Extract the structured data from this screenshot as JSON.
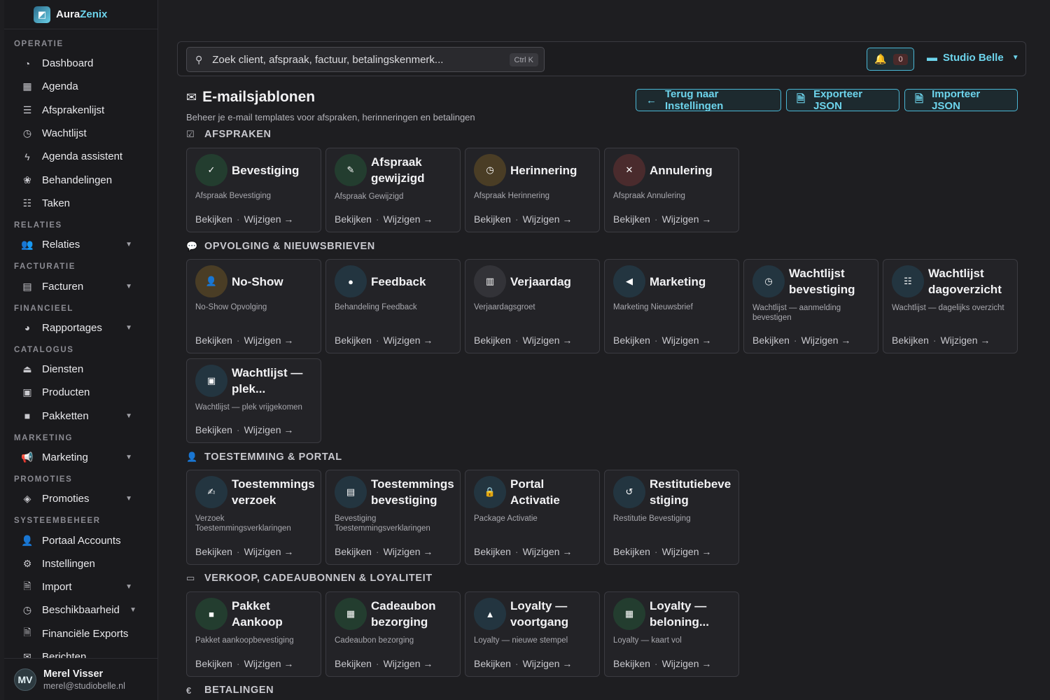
{
  "brand": {
    "name_part1": "Aura",
    "name_part2": "Zenix"
  },
  "sidebar": {
    "sections": [
      {
        "label": "OPERATIE"
      },
      {
        "label": "RELATIES"
      },
      {
        "label": "FACTURATIE"
      },
      {
        "label": "FINANCIEEL"
      },
      {
        "label": "CATALOGUS"
      },
      {
        "label": "MARKETING"
      },
      {
        "label": "PROMOTIES"
      },
      {
        "label": "SYSTEEMBEHEER"
      }
    ],
    "items": [
      {
        "label": "Dashboard",
        "icon": "dashboard-icon"
      },
      {
        "label": "Agenda",
        "icon": "calendar-icon"
      },
      {
        "label": "Afsprakenlijst",
        "icon": "list-icon"
      },
      {
        "label": "Wachtlijst",
        "icon": "clock-icon"
      },
      {
        "label": "Agenda assistent",
        "icon": "bolt-icon"
      },
      {
        "label": "Behandelingen",
        "icon": "lotus-icon"
      },
      {
        "label": "Taken",
        "icon": "tasks-icon"
      },
      {
        "label": "Relaties",
        "icon": "users-icon"
      },
      {
        "label": "Facturen",
        "icon": "invoice-icon"
      },
      {
        "label": "Rapportages",
        "icon": "pie-chart-icon"
      },
      {
        "label": "Diensten",
        "icon": "service-icon"
      },
      {
        "label": "Producten",
        "icon": "products-icon"
      },
      {
        "label": "Pakketten",
        "icon": "package-icon"
      },
      {
        "label": "Marketing",
        "icon": "megaphone-icon"
      },
      {
        "label": "Promoties",
        "icon": "tags-icon"
      },
      {
        "label": "Portaal Accounts",
        "icon": "user-cog-icon"
      },
      {
        "label": "Instellingen",
        "icon": "gear-icon"
      },
      {
        "label": "Import",
        "icon": "file-import-icon"
      },
      {
        "label": "Beschikbaarheid",
        "icon": "clock-icon"
      },
      {
        "label": "Financiële Exports",
        "icon": "file-export-icon"
      },
      {
        "label": "Berichten",
        "icon": "envelope-open-icon"
      }
    ]
  },
  "user": {
    "initials": "MV",
    "name": "Merel Visser",
    "email": "merel@studiobelle.nl"
  },
  "search": {
    "placeholder": "Zoek client, afspraak, factuur, betalingskenmerk...",
    "shortcut": "Ctrl K"
  },
  "notifications": {
    "count": "0"
  },
  "studio": {
    "label": "Studio Belle"
  },
  "page": {
    "title": "E-mailsjablonen",
    "subtitle": "Beheer je e-mail templates voor afspraken, herinneringen en betalingen",
    "buttons": {
      "back": "Terug naar Instellingen",
      "export": "Exporteer JSON",
      "import": "Importeer JSON"
    }
  },
  "card_actions": {
    "view": "Bekijken",
    "edit": "Wijzigen →"
  },
  "sections": {
    "afspraken": "AFSPRAKEN",
    "opvolging": "OPVOLGING & NIEUWSBRIEVEN",
    "toestemming": "TOESTEMMING & PORTAL",
    "verkoop": "VERKOOP, CADEAUBONNEN & LOYALITEIT",
    "betalingen": "BETALINGEN"
  },
  "cards": {
    "afspraken": [
      {
        "title": "Bevestiging",
        "subtitle": "Afspraak Bevestiging",
        "icon": "check-icon",
        "color": "#233d2f"
      },
      {
        "title": "Afspraak gewijzigd",
        "subtitle": "Afspraak Gewijzigd",
        "icon": "pencil-icon",
        "color": "#233d2f"
      },
      {
        "title": "Herinnering",
        "subtitle": "Afspraak Herinnering",
        "icon": "clock-icon",
        "color": "#4a3d25"
      },
      {
        "title": "Annulering",
        "subtitle": "Afspraak Annulering",
        "icon": "close-icon",
        "color": "#4a2b2d"
      }
    ],
    "opvolging": [
      {
        "title": "No-Show",
        "subtitle": "No-Show Opvolging",
        "icon": "user-x-icon",
        "color": "#4a3d25"
      },
      {
        "title": "Feedback",
        "subtitle": "Behandeling Feedback",
        "icon": "chat-icon",
        "color": "#233540"
      },
      {
        "title": "Verjaardag",
        "subtitle": "Verjaardagsgroet",
        "icon": "cake-icon",
        "color": "#333338"
      },
      {
        "title": "Marketing",
        "subtitle": "Marketing Nieuwsbrief",
        "icon": "megaphone-icon",
        "color": "#233540"
      },
      {
        "title": "Wachtlijst bevestiging",
        "subtitle": "Wachtlijst — aanmelding bevestigen",
        "icon": "clock-icon",
        "color": "#233540"
      },
      {
        "title": "Wachtlijst dagoverzicht",
        "subtitle": "Wachtlijst — dagelijks overzicht",
        "icon": "list-icon",
        "color": "#233540"
      },
      {
        "title": "Wachtlijst — plek...",
        "subtitle": "Wachtlijst — plek vrijgekomen",
        "icon": "calendar-check-icon",
        "color": "#233540"
      }
    ],
    "toestemming": [
      {
        "title": "Toestemmings verzoek",
        "subtitle": "Verzoek Toestemmingsverklaringen",
        "icon": "signature-icon",
        "color": "#233540"
      },
      {
        "title": "Toestemmings bevestiging",
        "subtitle": "Bevestiging Toestemmingsverklaringen",
        "icon": "file-check-icon",
        "color": "#233540"
      },
      {
        "title": "Portal Activatie",
        "subtitle": "Package Activatie",
        "icon": "lock-icon",
        "color": "#233540"
      },
      {
        "title": "Restitutiebeve stiging",
        "subtitle": "Restitutie Bevestiging",
        "icon": "undo-icon",
        "color": "#233540"
      }
    ],
    "verkoop": [
      {
        "title": "Pakket Aankoop",
        "subtitle": "Pakket aankoopbevestiging",
        "icon": "box-icon",
        "color": "#233d2f"
      },
      {
        "title": "Cadeaubon bezorging",
        "subtitle": "Cadeaubon bezorging",
        "icon": "gift-icon",
        "color": "#233d2f"
      },
      {
        "title": "Loyalty — voortgang",
        "subtitle": "Loyalty — nieuwe stempel",
        "icon": "stamp-icon",
        "color": "#233540"
      },
      {
        "title": "Loyalty — beloning...",
        "subtitle": "Loyalty — kaart vol",
        "icon": "gift-icon",
        "color": "#233d2f"
      }
    ]
  }
}
